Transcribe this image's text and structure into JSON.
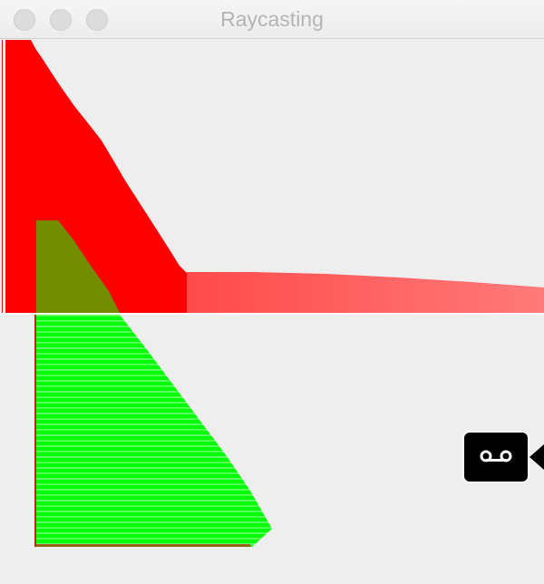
{
  "window": {
    "title": "Raycasting"
  },
  "icons": {
    "close": "traffic-light-close",
    "minimize": "traffic-light-minimize",
    "maximize": "traffic-light-maximize",
    "camera": "tape-camera-icon"
  },
  "colors": {
    "wall": "#ff0000",
    "wall_far": "#ff8080",
    "ray_fan": "#00ff00",
    "background": "#eeeeee"
  }
}
